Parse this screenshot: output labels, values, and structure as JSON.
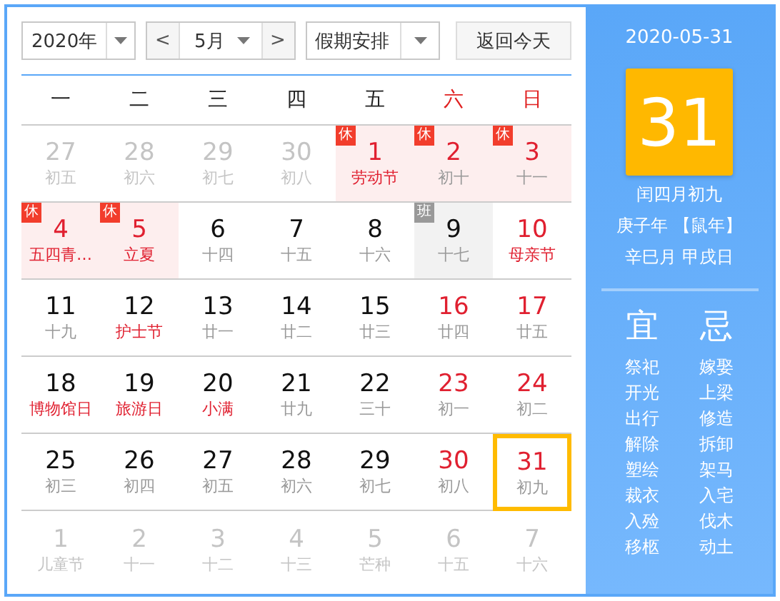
{
  "toolbar": {
    "year": "2020年",
    "prev": "<",
    "month": "5月",
    "next": ">",
    "holiday": "假期安排",
    "today_button": "返回今天"
  },
  "weekdays": [
    {
      "label": "一",
      "weekend": false
    },
    {
      "label": "二",
      "weekend": false
    },
    {
      "label": "三",
      "weekend": false
    },
    {
      "label": "四",
      "weekend": false
    },
    {
      "label": "五",
      "weekend": false
    },
    {
      "label": "六",
      "weekend": true
    },
    {
      "label": "日",
      "weekend": true
    }
  ],
  "weeks": [
    [
      {
        "day": "27",
        "lunar": "初五",
        "other_month": true,
        "selected": false
      },
      {
        "day": "28",
        "lunar": "初六",
        "other_month": true,
        "selected": false
      },
      {
        "day": "29",
        "lunar": "初七",
        "other_month": true,
        "selected": false
      },
      {
        "day": "30",
        "lunar": "初八",
        "other_month": true,
        "selected": false
      },
      {
        "day": "1",
        "lunar": "劳动节",
        "other_month": false,
        "red": true,
        "festival": true,
        "selected": false,
        "badge": {
          "text": "休",
          "kind": "rest"
        }
      },
      {
        "day": "2",
        "lunar": "初十",
        "other_month": false,
        "red": true,
        "festival": false,
        "selected": false,
        "badge": {
          "text": "休",
          "kind": "rest"
        }
      },
      {
        "day": "3",
        "lunar": "十一",
        "other_month": false,
        "red": true,
        "festival": false,
        "selected": false,
        "badge": {
          "text": "休",
          "kind": "rest"
        }
      }
    ],
    [
      {
        "day": "4",
        "lunar": "五四青…",
        "other_month": false,
        "red": true,
        "festival": true,
        "selected": false,
        "badge": {
          "text": "休",
          "kind": "rest"
        }
      },
      {
        "day": "5",
        "lunar": "立夏",
        "other_month": false,
        "red": true,
        "festival": true,
        "selected": false,
        "badge": {
          "text": "休",
          "kind": "rest"
        }
      },
      {
        "day": "6",
        "lunar": "十四",
        "other_month": false,
        "red": false,
        "festival": false,
        "selected": false
      },
      {
        "day": "7",
        "lunar": "十五",
        "other_month": false,
        "red": false,
        "festival": false,
        "selected": false
      },
      {
        "day": "8",
        "lunar": "十六",
        "other_month": false,
        "red": false,
        "festival": false,
        "selected": false
      },
      {
        "day": "9",
        "lunar": "十七",
        "other_month": false,
        "red": false,
        "festival": false,
        "selected": false,
        "badge": {
          "text": "班",
          "kind": "work"
        }
      },
      {
        "day": "10",
        "lunar": "母亲节",
        "other_month": false,
        "red": true,
        "festival": true,
        "selected": false
      }
    ],
    [
      {
        "day": "11",
        "lunar": "十九",
        "other_month": false,
        "red": false,
        "festival": false,
        "selected": false
      },
      {
        "day": "12",
        "lunar": "护士节",
        "other_month": false,
        "red": false,
        "festival": true,
        "selected": false
      },
      {
        "day": "13",
        "lunar": "廿一",
        "other_month": false,
        "red": false,
        "festival": false,
        "selected": false
      },
      {
        "day": "14",
        "lunar": "廿二",
        "other_month": false,
        "red": false,
        "festival": false,
        "selected": false
      },
      {
        "day": "15",
        "lunar": "廿三",
        "other_month": false,
        "red": false,
        "festival": false,
        "selected": false
      },
      {
        "day": "16",
        "lunar": "廿四",
        "other_month": false,
        "red": true,
        "festival": false,
        "selected": false
      },
      {
        "day": "17",
        "lunar": "廿五",
        "other_month": false,
        "red": true,
        "festival": false,
        "selected": false
      }
    ],
    [
      {
        "day": "18",
        "lunar": "博物馆日",
        "other_month": false,
        "red": false,
        "festival": true,
        "selected": false
      },
      {
        "day": "19",
        "lunar": "旅游日",
        "other_month": false,
        "red": false,
        "festival": true,
        "selected": false
      },
      {
        "day": "20",
        "lunar": "小满",
        "other_month": false,
        "red": false,
        "festival": true,
        "selected": false
      },
      {
        "day": "21",
        "lunar": "廿九",
        "other_month": false,
        "red": false,
        "festival": false,
        "selected": false
      },
      {
        "day": "22",
        "lunar": "三十",
        "other_month": false,
        "red": false,
        "festival": false,
        "selected": false
      },
      {
        "day": "23",
        "lunar": "初一",
        "other_month": false,
        "red": true,
        "festival": false,
        "selected": false
      },
      {
        "day": "24",
        "lunar": "初二",
        "other_month": false,
        "red": true,
        "festival": false,
        "selected": false
      }
    ],
    [
      {
        "day": "25",
        "lunar": "初三",
        "other_month": false,
        "red": false,
        "festival": false,
        "selected": false
      },
      {
        "day": "26",
        "lunar": "初四",
        "other_month": false,
        "red": false,
        "festival": false,
        "selected": false
      },
      {
        "day": "27",
        "lunar": "初五",
        "other_month": false,
        "red": false,
        "festival": false,
        "selected": false
      },
      {
        "day": "28",
        "lunar": "初六",
        "other_month": false,
        "red": false,
        "festival": false,
        "selected": false
      },
      {
        "day": "29",
        "lunar": "初七",
        "other_month": false,
        "red": false,
        "festival": false,
        "selected": false
      },
      {
        "day": "30",
        "lunar": "初八",
        "other_month": false,
        "red": true,
        "festival": false,
        "selected": false
      },
      {
        "day": "31",
        "lunar": "初九",
        "other_month": false,
        "red": true,
        "festival": false,
        "selected": true
      }
    ],
    [
      {
        "day": "1",
        "lunar": "儿童节",
        "other_month": true,
        "selected": false
      },
      {
        "day": "2",
        "lunar": "十一",
        "other_month": true,
        "selected": false
      },
      {
        "day": "3",
        "lunar": "十二",
        "other_month": true,
        "selected": false
      },
      {
        "day": "4",
        "lunar": "十三",
        "other_month": true,
        "selected": false
      },
      {
        "day": "5",
        "lunar": "芒种",
        "other_month": true,
        "selected": false
      },
      {
        "day": "6",
        "lunar": "十五",
        "other_month": true,
        "selected": false
      },
      {
        "day": "7",
        "lunar": "十六",
        "other_month": true,
        "selected": false
      }
    ]
  ],
  "detail": {
    "date": "2020-05-31",
    "day": "31",
    "lunar_date": "闰四月初九",
    "year_line": "庚子年 【鼠年】",
    "month_day_line": "辛巳月 甲戌日",
    "good": {
      "title": "宜",
      "items": [
        "祭祀",
        "开光",
        "出行",
        "解除",
        "塑绘",
        "裁衣",
        "入殓",
        "移柩"
      ]
    },
    "bad": {
      "title": "忌",
      "items": [
        "嫁娶",
        "上梁",
        "修造",
        "拆卸",
        "架马",
        "入宅",
        "伐木",
        "动土"
      ]
    }
  }
}
